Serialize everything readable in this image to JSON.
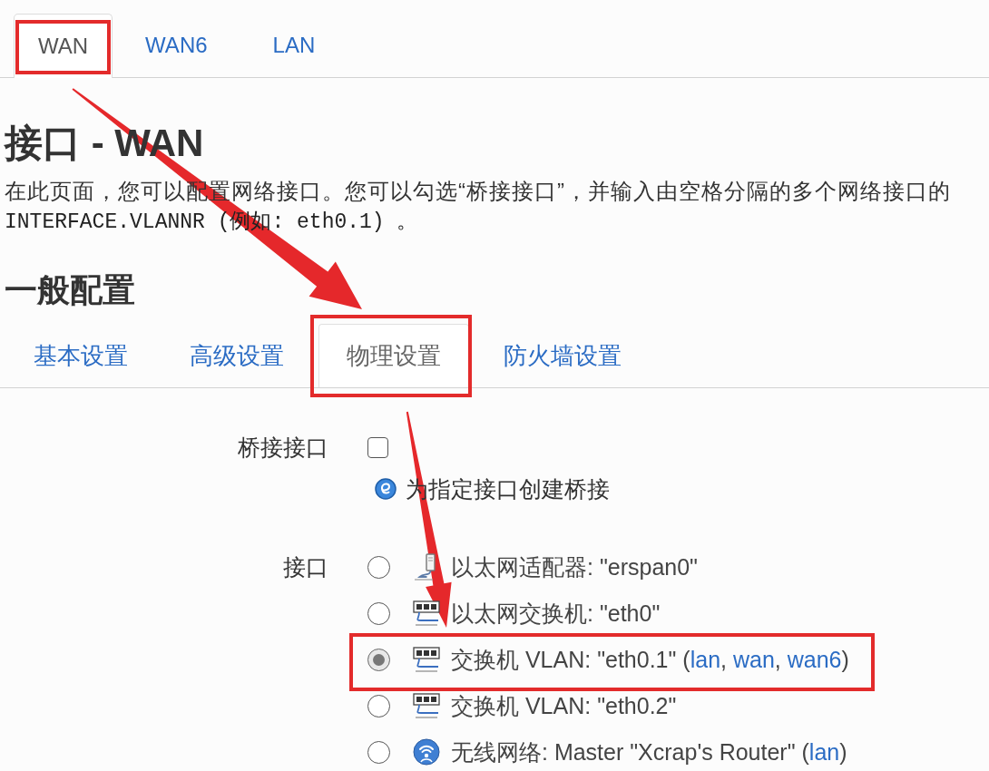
{
  "tabs": [
    {
      "label": "WAN",
      "selected": true,
      "highlighted": true
    },
    {
      "label": "WAN6",
      "selected": false,
      "highlighted": false
    },
    {
      "label": "LAN",
      "selected": false,
      "highlighted": false
    }
  ],
  "title": "接口 - WAN",
  "description": [
    {
      "kind": "prose",
      "text": "在此页面，您可以配置网络接口。您可以勾选“桥接接口”，并输入由空格分隔的多个网络接口的"
    },
    {
      "kind": "code",
      "text": "INTERFACE.VLANNR (例如: eth0.1) 。"
    }
  ],
  "section": {
    "title": "一般配置",
    "tabs": [
      {
        "label": "基本设置",
        "selected": false,
        "highlighted": false
      },
      {
        "label": "高级设置",
        "selected": false,
        "highlighted": false
      },
      {
        "label": "物理设置",
        "selected": true,
        "highlighted": true
      },
      {
        "label": "防火墙设置",
        "selected": false,
        "highlighted": false
      }
    ]
  },
  "form": {
    "fields": [
      {
        "kind": "checkbox",
        "label": "桥接接口",
        "checked": false,
        "help": "为指定接口创建桥接"
      },
      {
        "kind": "radio_list",
        "label": "接口",
        "options": [
          {
            "kind": "adapter",
            "selected": false,
            "highlighted": false,
            "parts": [
              {
                "kind": "text",
                "text": "以太网适配器: \"erspan0\""
              }
            ]
          },
          {
            "kind": "switch",
            "selected": false,
            "highlighted": false,
            "parts": [
              {
                "kind": "text",
                "text": "以太网交换机: \"eth0\""
              }
            ]
          },
          {
            "kind": "switch",
            "selected": true,
            "highlighted": true,
            "parts": [
              {
                "kind": "text",
                "text": "交换机 VLAN: \"eth0.1\" ("
              },
              {
                "kind": "link",
                "text": "lan"
              },
              {
                "kind": "text",
                "text": ", "
              },
              {
                "kind": "link",
                "text": "wan"
              },
              {
                "kind": "text",
                "text": ", "
              },
              {
                "kind": "link",
                "text": "wan6"
              },
              {
                "kind": "text",
                "text": ")"
              }
            ]
          },
          {
            "kind": "switch",
            "selected": false,
            "highlighted": false,
            "parts": [
              {
                "kind": "text",
                "text": "交换机 VLAN: \"eth0.2\""
              }
            ]
          },
          {
            "kind": "wireless",
            "selected": false,
            "highlighted": false,
            "parts": [
              {
                "kind": "text",
                "text": "无线网络: Master \"Xcrap's Router\" ("
              },
              {
                "kind": "link",
                "text": "lan"
              },
              {
                "kind": "text",
                "text": ")"
              }
            ]
          }
        ]
      }
    ]
  },
  "annotation_arrows": true
}
